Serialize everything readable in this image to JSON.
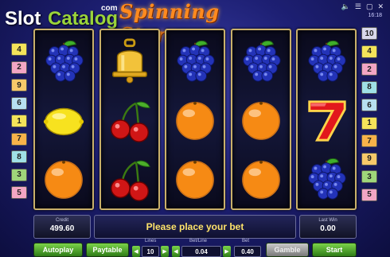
{
  "logo": {
    "slot": "Slot",
    "catalog": "Catalog",
    "com": "com"
  },
  "game_title": "Spinning Stars",
  "clock": "16:18",
  "paylines_left": [
    {
      "num": "4",
      "color": "#f4e35a"
    },
    {
      "num": "2",
      "color": "#f2a6c4"
    },
    {
      "num": "9",
      "color": "#f7c96a"
    },
    {
      "num": "6",
      "color": "#b7dff0"
    },
    {
      "num": "1",
      "color": "#f4e35a"
    },
    {
      "num": "7",
      "color": "#f7b24a"
    },
    {
      "num": "8",
      "color": "#9fe0e6"
    },
    {
      "num": "3",
      "color": "#9fd67a"
    },
    {
      "num": "5",
      "color": "#f2a6c4"
    }
  ],
  "paylines_right": [
    {
      "num": "10",
      "color": "#d8d8ea"
    },
    {
      "num": "4",
      "color": "#f4e35a"
    },
    {
      "num": "2",
      "color": "#f2a6c4"
    },
    {
      "num": "8",
      "color": "#9fe0e6"
    },
    {
      "num": "6",
      "color": "#b7dff0"
    },
    {
      "num": "1",
      "color": "#f4e35a"
    },
    {
      "num": "7",
      "color": "#f7b24a"
    },
    {
      "num": "9",
      "color": "#f7c96a"
    },
    {
      "num": "3",
      "color": "#9fd67a"
    },
    {
      "num": "5",
      "color": "#f2a6c4"
    }
  ],
  "reels": [
    [
      "grapes",
      "lemon",
      "orange"
    ],
    [
      "bell",
      "cherries",
      "cherries"
    ],
    [
      "grapes",
      "orange",
      "orange"
    ],
    [
      "grapes",
      "orange",
      "orange"
    ],
    [
      "grapes",
      "seven",
      "grapes"
    ]
  ],
  "info": {
    "credit_label": "Credit",
    "credit_value": "499.60",
    "message": "Please place your bet",
    "last_win_label": "Last Win",
    "last_win_value": "0.00"
  },
  "controls": {
    "autoplay": "Autoplay",
    "paytable": "Paytable",
    "lines_label": "Lines",
    "lines_value": "10",
    "bet_line_label": "Bet/Line",
    "bet_line_value": "0.04",
    "bet_label": "Bet",
    "bet_value": "0.40",
    "gamble": "Gamble",
    "start": "Start"
  },
  "colors": {
    "accent_green": "#4caf2a",
    "title_orange": "#ff8a1f",
    "message_yellow": "#ffe46a"
  }
}
